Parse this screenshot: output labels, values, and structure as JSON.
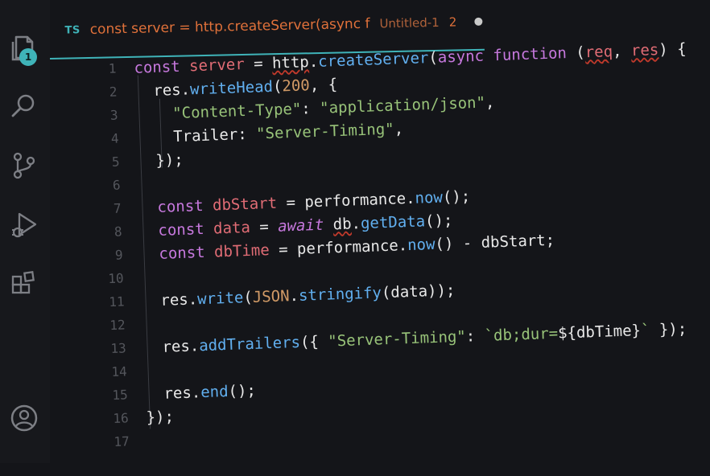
{
  "activity_bar": {
    "explorer_badge": "1",
    "icons": [
      "explorer-icon",
      "search-icon",
      "source-control-icon",
      "run-debug-icon",
      "extensions-icon",
      "account-icon"
    ]
  },
  "tab": {
    "type_label": "TS",
    "title": "const server = http.createServer(async f",
    "subtitle": "Untitled-1",
    "problem_count": "2"
  },
  "editor": {
    "line_numbers": [
      "1",
      "2",
      "3",
      "4",
      "5",
      "6",
      "7",
      "8",
      "9",
      "10",
      "11",
      "12",
      "13",
      "14",
      "15",
      "16",
      "17"
    ]
  },
  "colors": {
    "background": "#141519",
    "accent": "#3fb3b8",
    "tab_title": "#e0713a",
    "keyword": "#c678dd",
    "variable": "#e06c75",
    "function": "#61afef",
    "string": "#98c379",
    "number": "#d19a66"
  }
}
